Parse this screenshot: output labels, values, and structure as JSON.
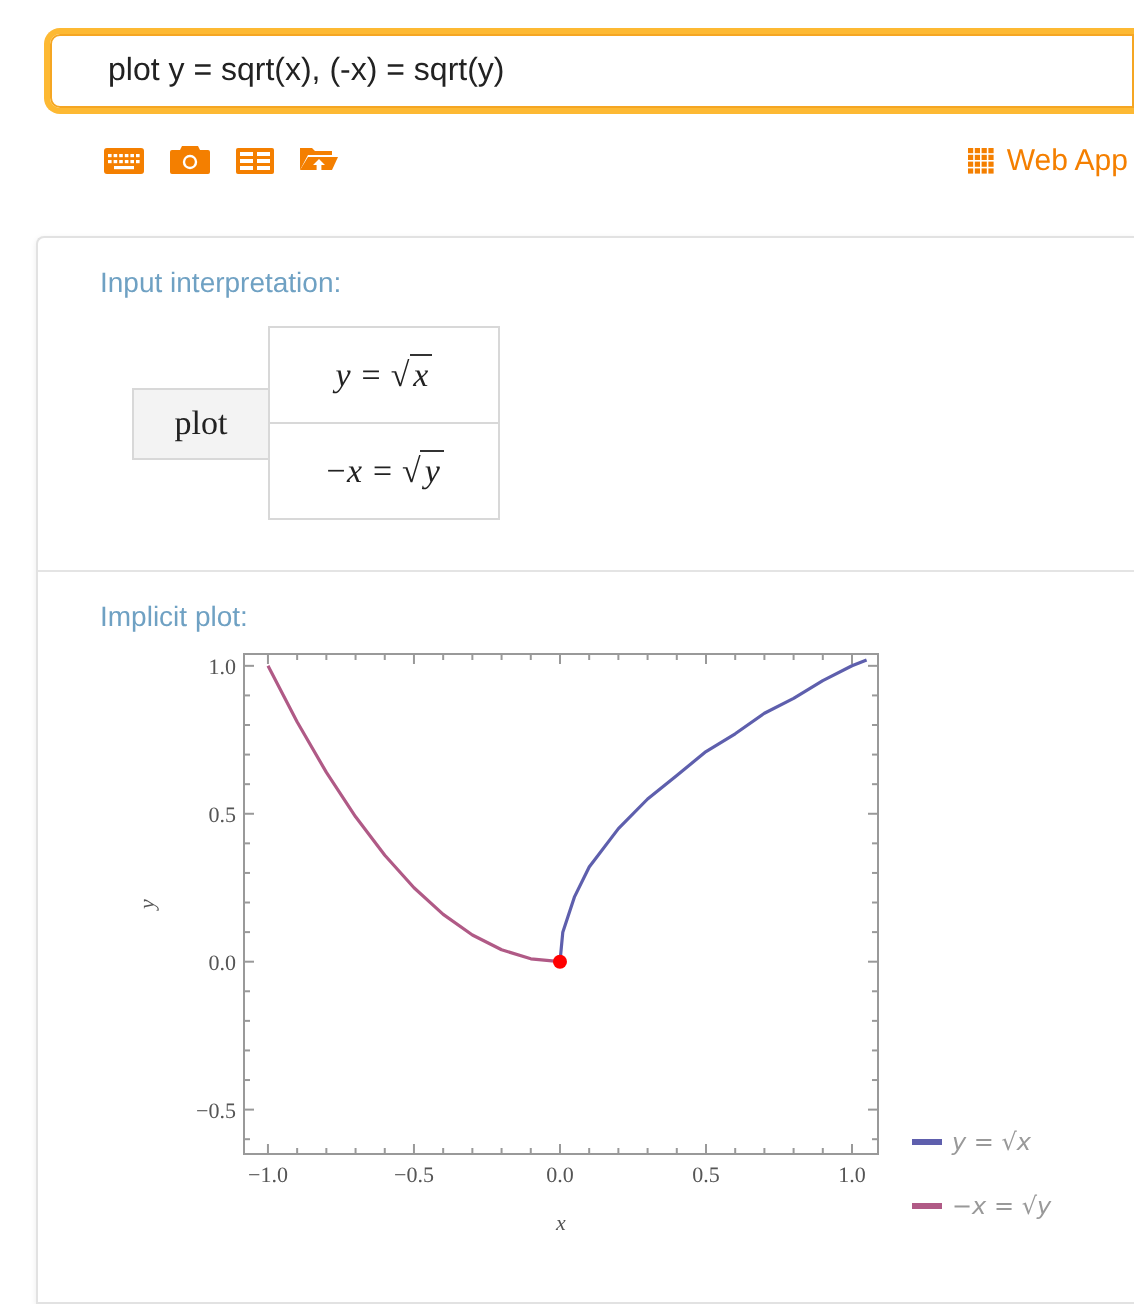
{
  "search": {
    "value": "plot y = sqrt(x), (-x) = sqrt(y)"
  },
  "toolbar": {
    "link": "Web App"
  },
  "pods": [
    {
      "kind": "interpretation",
      "title": "Input interpretation:",
      "operation": "plot",
      "equations": [
        {
          "lhs": "y =",
          "radical": "√",
          "radicand": "x"
        },
        {
          "lhs": "−x =",
          "radical": "√",
          "radicand": "y"
        }
      ]
    },
    {
      "kind": "plot",
      "title": "Implicit plot:",
      "intersection_point": {
        "color": "#ff0000"
      },
      "chart_data": {
        "type": "line",
        "xlabel": "x",
        "ylabel": "y",
        "legend": "right",
        "x": [
          -1,
          -0.9,
          -0.8,
          -0.7,
          -0.6,
          -0.5,
          -0.4,
          -0.3,
          -0.2,
          -0.1,
          0,
          0.01,
          0.05,
          0.1,
          0.2,
          0.3,
          0.4,
          0.5,
          0.6,
          0.7,
          0.8,
          0.9,
          1,
          1.05
        ],
        "series": [
          {
            "name": "y = √x",
            "color": "#5e5fad",
            "values": [
              null,
              null,
              null,
              null,
              null,
              null,
              null,
              null,
              null,
              null,
              0,
              0.1,
              0.22,
              0.32,
              0.45,
              0.55,
              0.63,
              0.71,
              0.77,
              0.84,
              0.89,
              0.95,
              1,
              1.02
            ]
          },
          {
            "name": "−x = √y",
            "color": "#b05a86",
            "values": [
              1,
              0.81,
              0.64,
              0.49,
              0.36,
              0.25,
              0.16,
              0.09,
              0.04,
              0.01,
              0,
              null,
              null,
              null,
              null,
              null,
              null,
              null,
              null,
              null,
              null,
              null,
              null,
              null
            ]
          }
        ],
        "xlim": [
          -1.082,
          1.089
        ],
        "ylim": [
          -0.65,
          1.04
        ],
        "xticks": [
          {
            "value": -1,
            "label": "−1.0"
          },
          {
            "value": -0.5,
            "label": "−0.5"
          },
          {
            "value": 0,
            "label": "0.0"
          },
          {
            "value": 0.5,
            "label": "0.5"
          },
          {
            "value": 1,
            "label": "1.0"
          }
        ],
        "yticks": [
          {
            "value": -0.5,
            "label": "−0.5"
          },
          {
            "value": 0,
            "label": "0.0"
          },
          {
            "value": 0.5,
            "label": "0.5"
          },
          {
            "value": 1,
            "label": "1.0"
          }
        ]
      }
    }
  ]
}
